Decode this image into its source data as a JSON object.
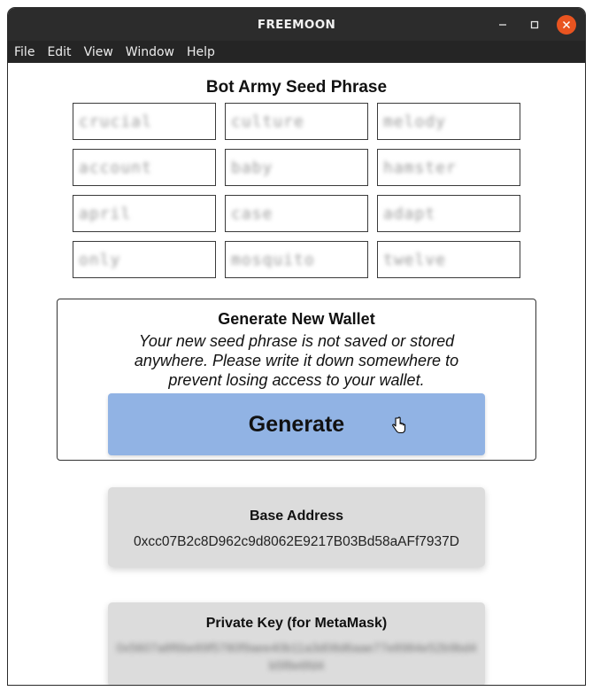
{
  "window": {
    "title": "FREEMOON",
    "controls": {
      "minimize": "–",
      "maximize": "☐",
      "close": "✕"
    }
  },
  "menu": [
    "File",
    "Edit",
    "View",
    "Window",
    "Help"
  ],
  "seed": {
    "title": "Bot Army Seed Phrase",
    "words": [
      "crucial",
      "culture",
      "melody",
      "account",
      "baby",
      "hamster",
      "april",
      "case",
      "adapt",
      "only",
      "mosquito",
      "twelve"
    ]
  },
  "generate": {
    "title": "Generate New Wallet",
    "description": "Your new seed phrase is not saved or stored anywhere. Please write it down somewhere to prevent losing access to your wallet.",
    "button_label": "Generate",
    "button_color": "#91b3e4"
  },
  "address": {
    "label": "Base Address",
    "value": "0xcc07B2c8D962c9d8062E9217B03Bd58aAFf7937D"
  },
  "private_key": {
    "label": "Private Key (for MetaMask)",
    "value": "0x5607a8f6be89f5780f9aee40b11a3d08d6aae77e8984e52b9bd4b5f8e6fd4"
  },
  "colors": {
    "titlebar": "#2c2c2c",
    "close": "#e95420",
    "card": "#dcdcdc"
  }
}
